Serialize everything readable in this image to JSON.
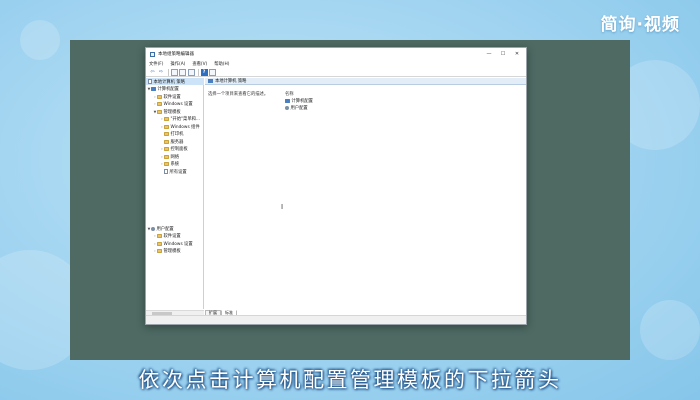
{
  "brand": "简询·视频",
  "caption": "依次点击计算机配置管理模板的下拉箭头",
  "window": {
    "title": "本地组策略编辑器",
    "controls": [
      "—",
      "☐",
      "✕"
    ]
  },
  "menu": [
    "文件(F)",
    "操作(A)",
    "查看(V)",
    "帮助(H)"
  ],
  "toolbar": {
    "back": "⇦",
    "forward": "⇨",
    "help": "?"
  },
  "tree": {
    "root": "本地计算机 策略",
    "computer": "计算机配置",
    "computer_children": [
      "软件设置",
      "Windows 设置",
      "管理模板"
    ],
    "admin_children": [
      "\"开始\"菜单和...",
      "Windows 组件",
      "打印机",
      "服务器",
      "控制面板",
      "网络",
      "系统",
      "所有设置"
    ],
    "user": "用户配置",
    "user_children": [
      "软件设置",
      "Windows 设置",
      "管理模板"
    ]
  },
  "right_pane": {
    "header": "本地计算机 策略",
    "description": "选择一个项目来查看它的描述。",
    "column": "名称",
    "items": [
      "计算机配置",
      "用户配置"
    ]
  },
  "tabs": [
    "扩展",
    "标准"
  ],
  "icons": {
    "expand_open": "chevron-down-icon",
    "expand_closed": "chevron-right-icon",
    "folder": "folder-icon",
    "computer": "computer-icon",
    "user": "user-icon",
    "policy": "document-icon",
    "cursor": "text-cursor-icon"
  }
}
